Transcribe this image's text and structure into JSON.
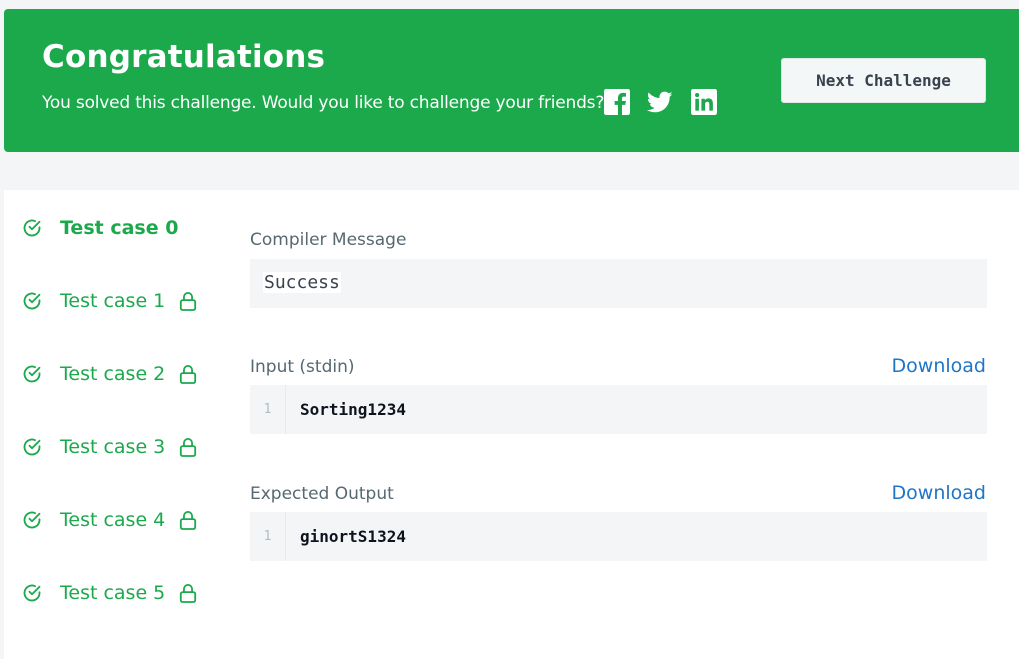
{
  "banner": {
    "title": "Congratulations",
    "subtitle": "You solved this challenge. Would you like to challenge your friends?",
    "share": [
      "facebook-icon",
      "twitter-icon",
      "linkedin-icon"
    ],
    "next_label": "Next Challenge"
  },
  "test_cases": [
    {
      "label": "Test case 0",
      "passed": true,
      "locked": false,
      "active": true
    },
    {
      "label": "Test case 1",
      "passed": true,
      "locked": true,
      "active": false
    },
    {
      "label": "Test case 2",
      "passed": true,
      "locked": true,
      "active": false
    },
    {
      "label": "Test case 3",
      "passed": true,
      "locked": true,
      "active": false
    },
    {
      "label": "Test case 4",
      "passed": true,
      "locked": true,
      "active": false
    },
    {
      "label": "Test case 5",
      "passed": true,
      "locked": true,
      "active": false
    }
  ],
  "compiler": {
    "label": "Compiler Message",
    "message": "Success"
  },
  "input": {
    "label": "Input (stdin)",
    "download": "Download",
    "line_no": "1",
    "code": "Sorting1234"
  },
  "expected": {
    "label": "Expected Output",
    "download": "Download",
    "line_no": "1",
    "code": "ginortS1324"
  },
  "colors": {
    "brand_green": "#1ba94c",
    "link_blue": "#1f75c7"
  }
}
